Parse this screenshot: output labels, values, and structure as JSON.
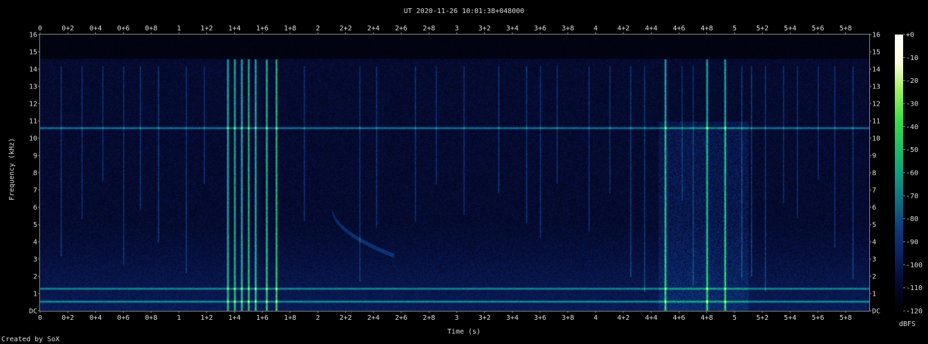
{
  "chart_data": {
    "type": "heatmap",
    "title": "UT 2020-11-26 10:01:38+048000",
    "xlabel": "Time (s)",
    "ylabel": "Frequency (kHz)",
    "xlim": [
      0,
      5.97
    ],
    "ylim": [
      0,
      16
    ],
    "x_ticks": [
      "0",
      "0+2",
      "0+4",
      "0+6",
      "0+8",
      "1",
      "1+2",
      "1+4",
      "1+6",
      "1+8",
      "2",
      "2+2",
      "2+4",
      "2+6",
      "2+8",
      "3",
      "3+2",
      "3+4",
      "3+6",
      "3+8",
      "4",
      "4+2",
      "4+4",
      "4+6",
      "4+8",
      "5",
      "5+2",
      "5+4",
      "5+6",
      "5+8"
    ],
    "x_tick_values": [
      0,
      0.2,
      0.4,
      0.6,
      0.8,
      1.0,
      1.2,
      1.4,
      1.6,
      1.8,
      2.0,
      2.2,
      2.4,
      2.6,
      2.8,
      3.0,
      3.2,
      3.4,
      3.6,
      3.8,
      4.0,
      4.2,
      4.4,
      4.6,
      4.8,
      5.0,
      5.2,
      5.4,
      5.6,
      5.8
    ],
    "y_ticks": [
      "DC",
      "1",
      "2",
      "3",
      "4",
      "5",
      "6",
      "7",
      "8",
      "9",
      "10",
      "11",
      "12",
      "13",
      "14",
      "15",
      "16"
    ],
    "y_tick_values": [
      0,
      1,
      2,
      3,
      4,
      5,
      6,
      7,
      8,
      9,
      10,
      11,
      12,
      13,
      14,
      15,
      16
    ],
    "colorbar": {
      "label": "dBFS",
      "ticks": [
        "+0",
        "-10",
        "-20",
        "-30",
        "-40",
        "-50",
        "-60",
        "-70",
        "-80",
        "-90",
        "-100",
        "-110",
        "-120"
      ],
      "range": [
        -120,
        0
      ],
      "colors": [
        "#000000",
        "#050a30",
        "#0a2060",
        "#0d3c80",
        "#107080",
        "#10a080",
        "#20c060",
        "#40e040",
        "#a0f060",
        "#ffffe0",
        "#ffffff"
      ]
    },
    "features": {
      "hum_lines_khz": [
        0.55,
        1.3,
        10.6
      ],
      "strong_vertical_events_s": [
        1.35,
        1.4,
        1.45,
        1.5,
        1.55,
        1.63,
        1.7,
        4.5,
        4.8,
        4.93
      ],
      "weak_vertical_events_s": [
        0.15,
        0.3,
        0.45,
        0.6,
        0.72,
        0.85,
        1.05,
        1.18,
        1.9,
        2.3,
        2.42,
        2.7,
        2.85,
        3.05,
        3.3,
        3.5,
        3.6,
        3.72,
        3.95,
        4.1,
        4.25,
        4.35,
        4.62,
        4.7,
        5.05,
        5.12,
        5.22,
        5.35,
        5.45,
        5.6,
        5.72,
        5.85
      ],
      "whistler": {
        "start_s": 2.1,
        "end_s": 2.55,
        "start_khz": 6.0,
        "end_khz": 3.2
      }
    }
  },
  "footer": {
    "credit": "Created by SoX"
  }
}
